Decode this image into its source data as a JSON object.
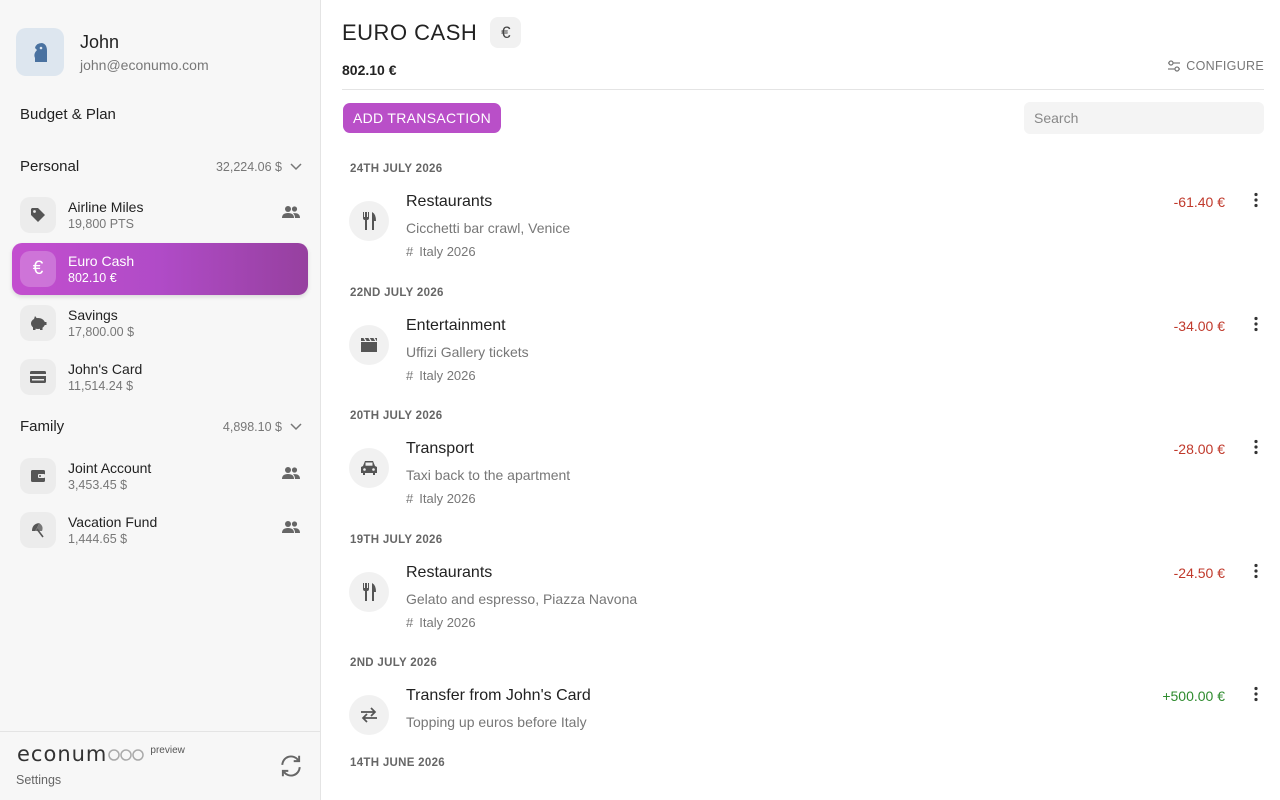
{
  "user": {
    "name": "John",
    "email": "john@econumo.com"
  },
  "nav": {
    "budget_label": "Budget & Plan"
  },
  "groups": [
    {
      "name": "Personal",
      "total": "32,224.06 $"
    },
    {
      "name": "Family",
      "total": "4,898.10 $"
    }
  ],
  "accounts": [
    {
      "name": "Airline Miles",
      "balance": "19,800 PTS",
      "icon": "tag-icon",
      "shared": true
    },
    {
      "name": "Euro Cash",
      "balance": "802.10 €",
      "icon": "euro-icon",
      "shared": false,
      "active": true
    },
    {
      "name": "Savings",
      "balance": "17,800.00 $",
      "icon": "piggy-bank-icon",
      "shared": false
    },
    {
      "name": "John's Card",
      "balance": "11,514.24 $",
      "icon": "credit-card-icon",
      "shared": false
    },
    {
      "name": "Joint Account",
      "balance": "3,453.45 $",
      "icon": "wallet-icon",
      "shared": true
    },
    {
      "name": "Vacation Fund",
      "balance": "1,444.65 $",
      "icon": "beach-umbrella-icon",
      "shared": true
    }
  ],
  "footer": {
    "brand": "econum",
    "preview": "preview",
    "settings": "Settings"
  },
  "header": {
    "title": "EURO CASH",
    "currency_symbol": "€",
    "balance": "802.10 €",
    "configure": "CONFIGURE"
  },
  "toolbar": {
    "add_label": "ADD TRANSACTION",
    "search_placeholder": "Search"
  },
  "dates": [
    "24TH JULY 2026",
    "22ND JULY 2026",
    "20TH JULY 2026",
    "19TH JULY 2026",
    "2ND JULY 2026",
    "14TH JUNE 2026"
  ],
  "transactions": [
    {
      "category": "Restaurants",
      "description": "Cicchetti bar crawl, Venice",
      "tag": "Italy 2026",
      "amount": "-61.40 €",
      "icon": "fork-knife-icon"
    },
    {
      "category": "Entertainment",
      "description": "Uffizi Gallery tickets",
      "tag": "Italy 2026",
      "amount": "-34.00 €",
      "icon": "clapperboard-icon"
    },
    {
      "category": "Transport",
      "description": "Taxi back to the apartment",
      "tag": "Italy 2026",
      "amount": "-28.00 €",
      "icon": "car-icon"
    },
    {
      "category": "Restaurants",
      "description": "Gelato and espresso, Piazza Navona",
      "tag": "Italy 2026",
      "amount": "-24.50 €",
      "icon": "fork-knife-icon"
    },
    {
      "category": "Transfer from John's Card",
      "description": "Topping up euros before Italy",
      "tag": "",
      "amount": "+500.00 €",
      "icon": "transfer-arrows-icon"
    }
  ],
  "colors": {
    "accent": "#b94fc8",
    "negative": "#c0392b",
    "positive": "#2e8b2e"
  }
}
